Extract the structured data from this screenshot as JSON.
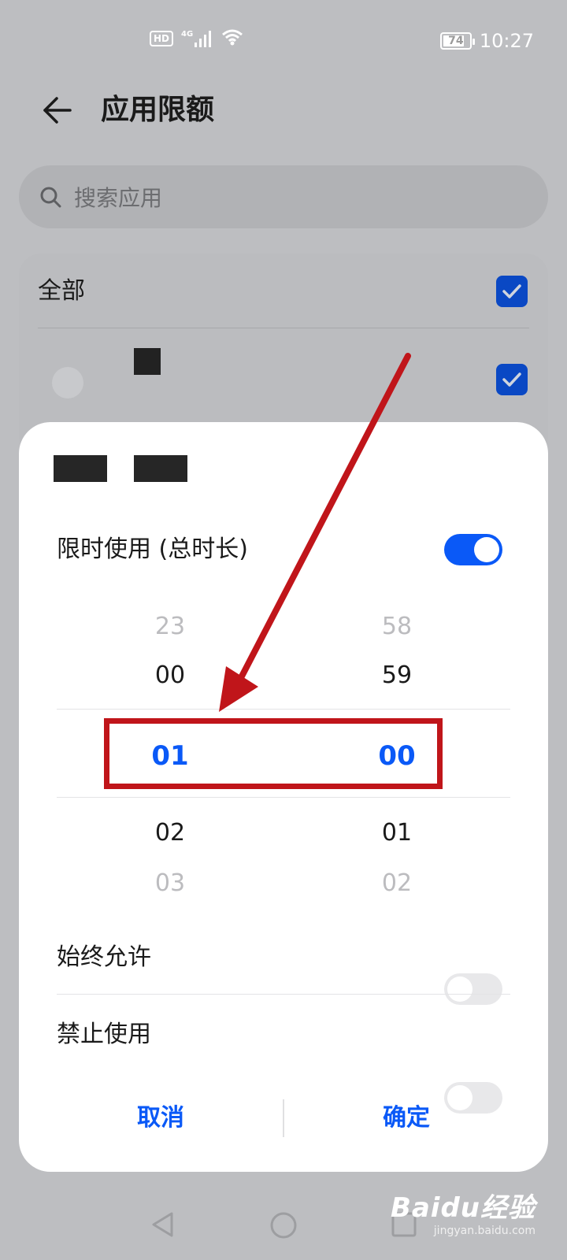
{
  "status_bar": {
    "hd_badge": "HD",
    "network": "4G",
    "battery_level": "74",
    "time": "10:27"
  },
  "header": {
    "title": "应用限额"
  },
  "search": {
    "placeholder": "搜索应用"
  },
  "app_list": {
    "all_label": "全部",
    "all_checked": true,
    "item_checked": true
  },
  "sheet": {
    "limit_label": "限时使用 (总时长)",
    "limit_enabled": true,
    "hours": [
      "23",
      "00",
      "01",
      "02",
      "03"
    ],
    "minutes": [
      "58",
      "59",
      "00",
      "01",
      "02"
    ],
    "selected_hour": "01",
    "selected_minute": "00",
    "always_allow_label": "始终允许",
    "always_allow_enabled": false,
    "forbid_label": "禁止使用",
    "forbid_enabled": false,
    "cancel_label": "取消",
    "confirm_label": "确定"
  },
  "watermark": {
    "main": "Baidu经验",
    "sub": "jingyan.baidu.com"
  },
  "colors": {
    "accent": "#0a59f7",
    "annotation": "#c0151a",
    "overlay": "#bdbec1"
  }
}
